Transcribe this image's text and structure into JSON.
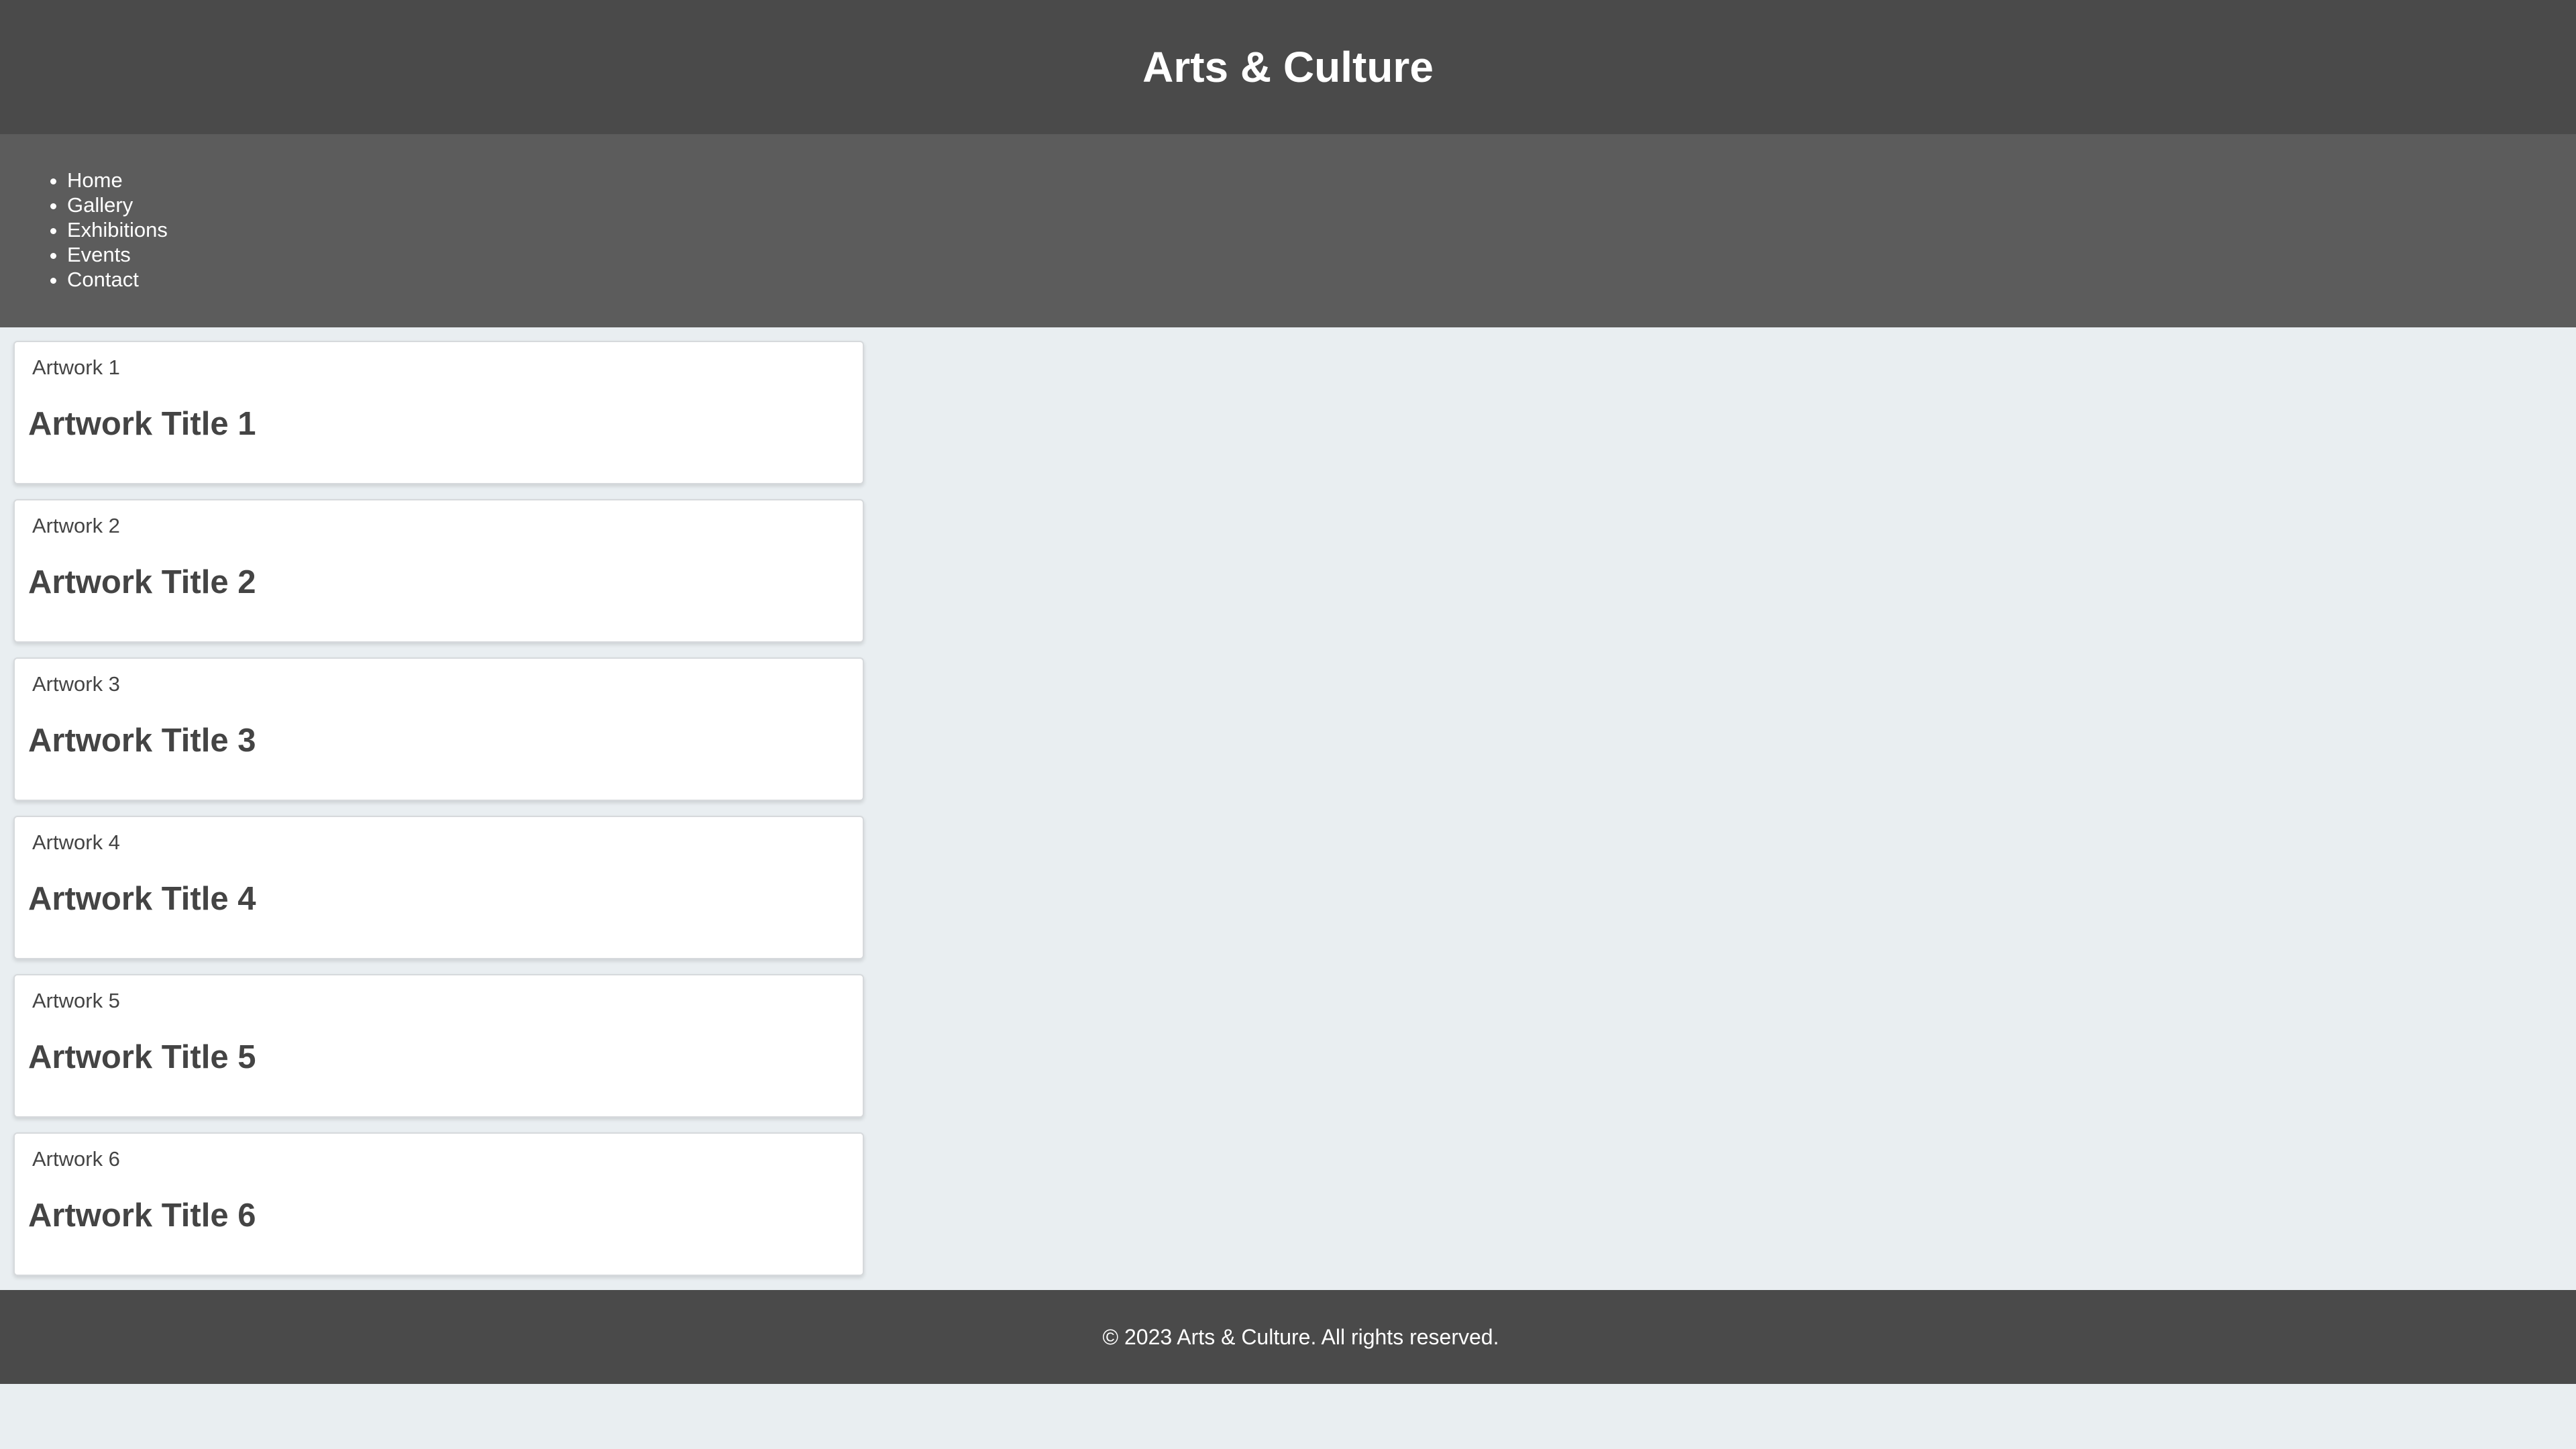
{
  "header": {
    "title": "Arts & Culture"
  },
  "nav": {
    "items": [
      {
        "label": "Home"
      },
      {
        "label": "Gallery"
      },
      {
        "label": "Exhibitions"
      },
      {
        "label": "Events"
      },
      {
        "label": "Contact"
      }
    ]
  },
  "gallery": {
    "cards": [
      {
        "alt": "Artwork 1",
        "title": "Artwork Title 1"
      },
      {
        "alt": "Artwork 2",
        "title": "Artwork Title 2"
      },
      {
        "alt": "Artwork 3",
        "title": "Artwork Title 3"
      },
      {
        "alt": "Artwork 4",
        "title": "Artwork Title 4"
      },
      {
        "alt": "Artwork 5",
        "title": "Artwork Title 5"
      },
      {
        "alt": "Artwork 6",
        "title": "Artwork Title 6"
      }
    ]
  },
  "footer": {
    "text": "© 2023 Arts & Culture. All rights reserved."
  },
  "colors": {
    "header_bg": "#4a4a4a",
    "nav_bg": "#5c5c5c",
    "page_bg": "#e9eef1",
    "card_bg": "#ffffff",
    "text": "#444444"
  }
}
